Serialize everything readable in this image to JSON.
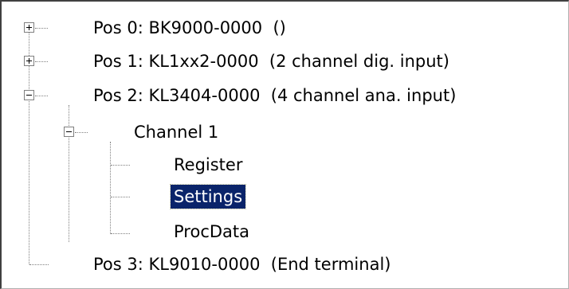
{
  "tree": {
    "nodes": [
      {
        "label": "Pos 0: BK9000-0000  ()",
        "expander": "plus"
      },
      {
        "label": "Pos 1: KL1xx2-0000  (2 channel dig. input)",
        "expander": "plus"
      },
      {
        "label": "Pos 2: KL3404-0000  (4 channel ana. input)",
        "expander": "minus"
      },
      {
        "label": "Channel 1",
        "expander": "minus"
      },
      {
        "label": "Register"
      },
      {
        "label": "Settings",
        "selected": true
      },
      {
        "label": "ProcData"
      },
      {
        "label": "Pos 3: KL9010-0000  (End terminal)"
      }
    ]
  },
  "colors": {
    "selection_bg": "#0a246a",
    "selection_text": "#ffffff",
    "tree_lines": "#808080"
  }
}
